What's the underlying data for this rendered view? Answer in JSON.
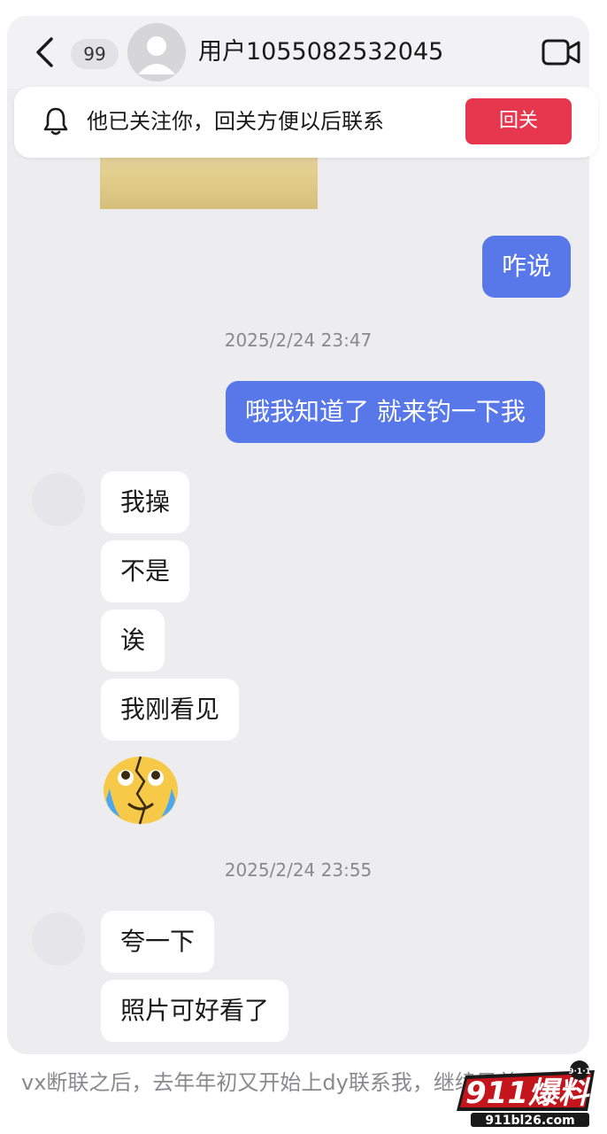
{
  "header": {
    "unread_badge": "99",
    "username": "用户1055082532045",
    "back_icon": "chevron-left-icon",
    "video_icon": "video-camera-icon"
  },
  "notice": {
    "text": "他已关注你，回关方便以后联系",
    "button": "回关",
    "icon": "bell-icon"
  },
  "messages": [
    {
      "dir": "out",
      "text": "咋说"
    },
    {
      "time": "2025/2/24 23:47"
    },
    {
      "dir": "out",
      "text": "哦我知道了 就来钓一下我"
    },
    {
      "dir": "in",
      "text": "我操"
    },
    {
      "dir": "in",
      "text": "不是"
    },
    {
      "dir": "in",
      "text": "诶"
    },
    {
      "dir": "in",
      "text": "我刚看见"
    },
    {
      "dir": "in",
      "emoji": "crying-broken-face-emoji"
    },
    {
      "time": "2025/2/24 23:55"
    },
    {
      "dir": "in",
      "text": "夸一下"
    },
    {
      "dir": "in",
      "text": "照片可好看了"
    }
  ],
  "caption": "vx断联之后，去年年初又开始上dy联系我，继续另着",
  "watermark": {
    "brand": "911爆料网",
    "badge": "9·1·1",
    "url": "911bl26.com"
  },
  "colors": {
    "outgoing_bubble": "#5878ea",
    "follow_button": "#e6374f",
    "chat_background": "#ededf0"
  }
}
